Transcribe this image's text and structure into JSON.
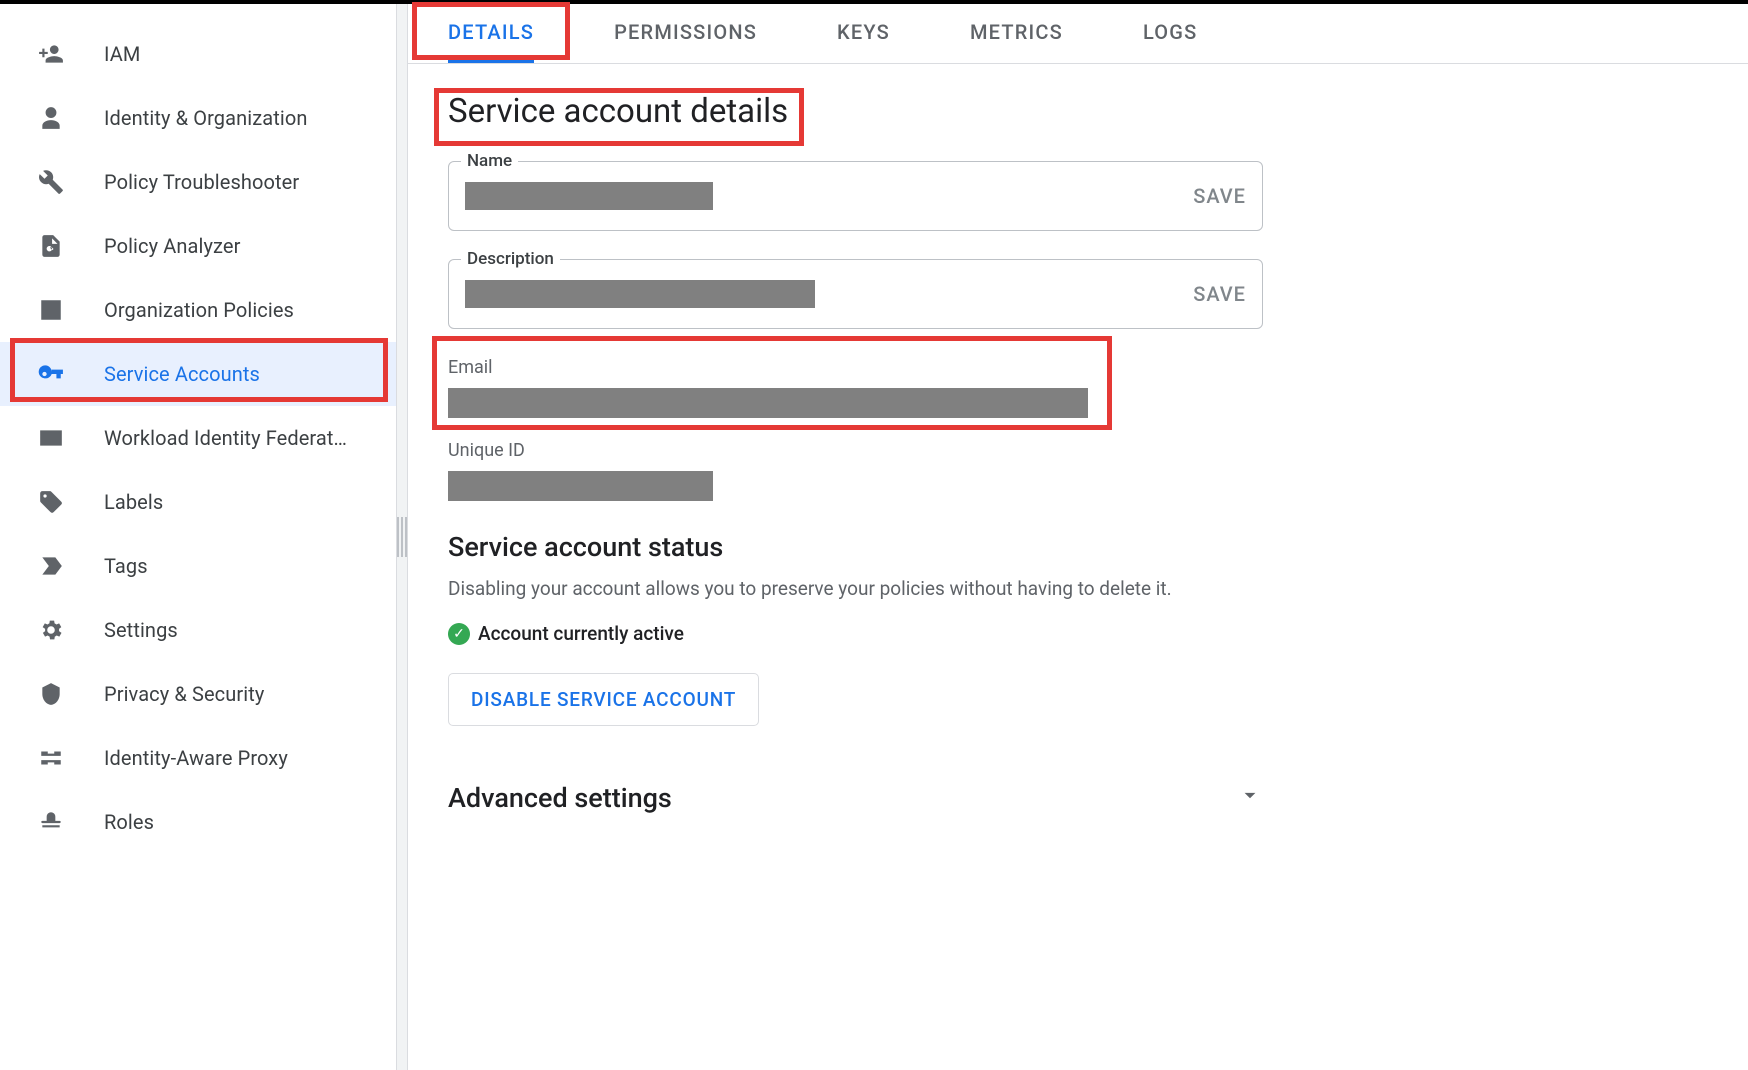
{
  "sidebar": {
    "items": [
      {
        "label": "IAM",
        "icon": "iam"
      },
      {
        "label": "Identity & Organization",
        "icon": "person"
      },
      {
        "label": "Policy Troubleshooter",
        "icon": "wrench"
      },
      {
        "label": "Policy Analyzer",
        "icon": "doc-search"
      },
      {
        "label": "Organization Policies",
        "icon": "list-box"
      },
      {
        "label": "Service Accounts",
        "icon": "key-badge"
      },
      {
        "label": "Workload Identity Federat…",
        "icon": "id-card"
      },
      {
        "label": "Labels",
        "icon": "tag"
      },
      {
        "label": "Tags",
        "icon": "bookmark"
      },
      {
        "label": "Settings",
        "icon": "gear"
      },
      {
        "label": "Privacy & Security",
        "icon": "shield"
      },
      {
        "label": "Identity-Aware Proxy",
        "icon": "proxy"
      },
      {
        "label": "Roles",
        "icon": "hat"
      }
    ],
    "active_index": 5
  },
  "tabs": {
    "items": [
      "DETAILS",
      "PERMISSIONS",
      "KEYS",
      "METRICS",
      "LOGS"
    ],
    "active_index": 0
  },
  "details": {
    "page_title": "Service account details",
    "name": {
      "label": "Name",
      "redact_w": 248,
      "save": "SAVE"
    },
    "description": {
      "label": "Description",
      "redact_w": 350,
      "save": "SAVE"
    },
    "email": {
      "label": "Email",
      "redact_w": 640
    },
    "unique_id": {
      "label": "Unique ID",
      "redact_w": 265
    },
    "status": {
      "heading": "Service account status",
      "hint": "Disabling your account allows you to preserve your policies without having to delete it.",
      "active_text": "Account currently active",
      "disable_btn": "DISABLE SERVICE ACCOUNT"
    },
    "advanced": {
      "heading": "Advanced settings"
    }
  }
}
